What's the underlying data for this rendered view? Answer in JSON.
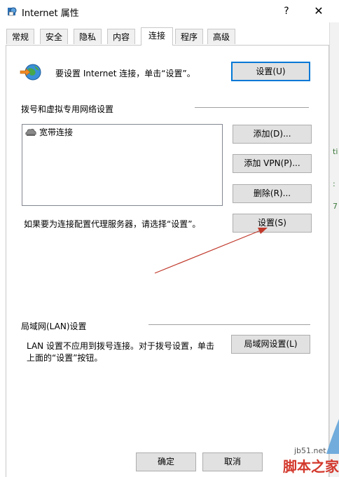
{
  "window": {
    "title": "Internet 属性",
    "help": "?",
    "close": "✕"
  },
  "tabs": [
    "常规",
    "安全",
    "隐私",
    "内容",
    "连接",
    "程序",
    "高级"
  ],
  "setup": {
    "text": "要设置 Internet 连接，单击“设置”。",
    "button": "设置(U)"
  },
  "dialup": {
    "heading": "拨号和虚拟专用网络设置",
    "connections": [
      "宽带连接"
    ],
    "add_button": "添加(D)...",
    "add_vpn_button": "添加 VPN(P)...",
    "remove_button": "删除(R)...",
    "proxy_text": "如果要为连接配置代理服务器，请选择“设置”。",
    "settings_button": "设置(S)"
  },
  "lan": {
    "heading": "局域网(LAN)设置",
    "text_line1": "LAN 设置不应用到拨号连接。对于拨号设置，单击",
    "text_line2": "上面的“设置”按钮。",
    "button": "局域网设置(L)"
  },
  "footer": {
    "ok_button": "确定",
    "cancel_button": "取消"
  },
  "watermark": {
    "brand": "jb51.net",
    "text": "脚本之家"
  },
  "colors": {
    "accent": "#0078d7",
    "annotation_arrow": "#c0392b",
    "watermark": "#d3382c"
  }
}
